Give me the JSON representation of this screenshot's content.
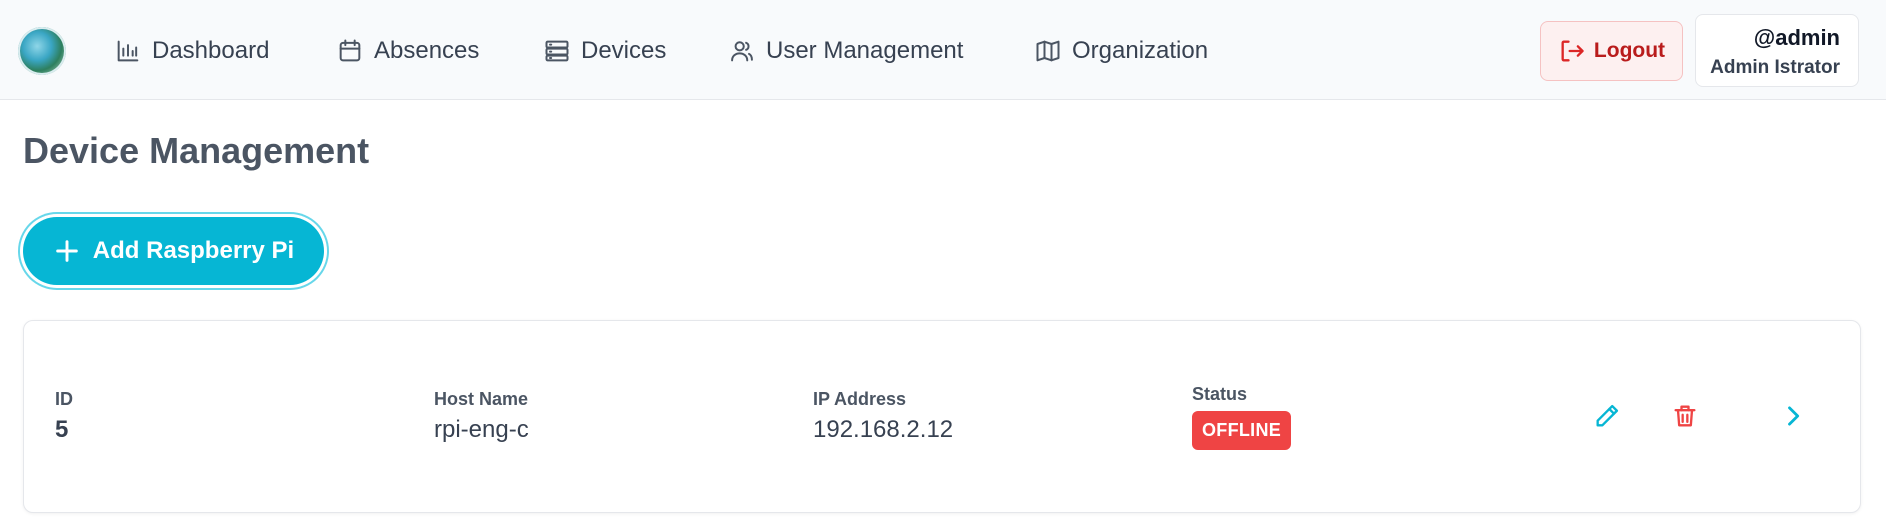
{
  "nav": {
    "items": [
      {
        "label": "Dashboard",
        "icon": "bar-chart-icon"
      },
      {
        "label": "Absences",
        "icon": "calendar-icon"
      },
      {
        "label": "Devices",
        "icon": "server-icon"
      },
      {
        "label": "User Management",
        "icon": "users-icon"
      },
      {
        "label": "Organization",
        "icon": "map-icon"
      }
    ],
    "logout_label": "Logout"
  },
  "user": {
    "handle": "@admin",
    "full_name": "Admin Istrator"
  },
  "page": {
    "title": "Device Management",
    "add_button_label": "Add Raspberry Pi"
  },
  "device": {
    "id_label": "ID",
    "id_value": "5",
    "host_label": "Host Name",
    "host_value": "rpi-eng-c",
    "ip_label": "IP Address",
    "ip_value": "192.168.2.12",
    "status_label": "Status",
    "status_value": "OFFLINE"
  },
  "colors": {
    "accent": "#06b6d4",
    "danger": "#ef4444",
    "logout_text": "#b91c1c"
  }
}
